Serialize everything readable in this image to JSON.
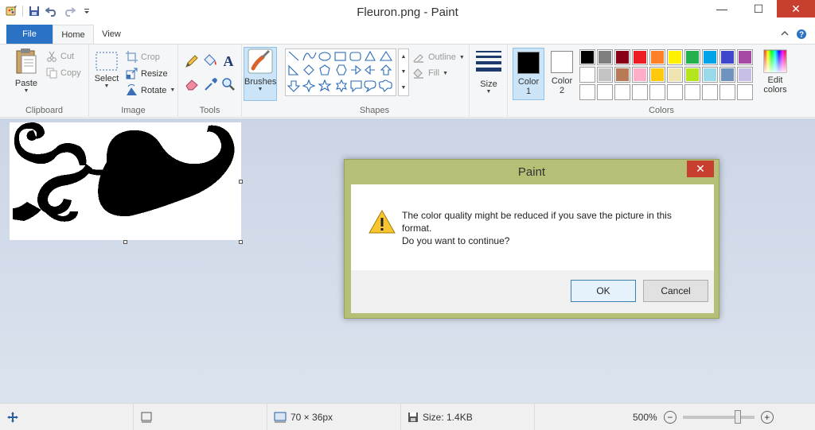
{
  "window": {
    "title": "Fleuron.png - Paint",
    "minimize_glyph": "—",
    "maximize_glyph": "☐",
    "close_glyph": "✕"
  },
  "tabs": [
    {
      "label": "File",
      "active": false
    },
    {
      "label": "Home",
      "active": true
    },
    {
      "label": "View",
      "active": false
    }
  ],
  "ribbon": {
    "clipboard": {
      "label": "Clipboard",
      "paste": "Paste",
      "cut": "Cut",
      "copy": "Copy"
    },
    "image": {
      "label": "Image",
      "select": "Select",
      "crop": "Crop",
      "resize": "Resize",
      "rotate": "Rotate"
    },
    "tools": {
      "label": "Tools"
    },
    "brushes": {
      "label": "Brushes"
    },
    "shapes": {
      "label": "Shapes",
      "outline": "Outline",
      "fill": "Fill"
    },
    "size": {
      "label": "Size"
    },
    "colors": {
      "label": "Colors",
      "color1_label": "Color",
      "color1_num": "1",
      "color1_value": "#000000",
      "color2_label": "Color",
      "color2_num": "2",
      "color2_value": "#ffffff",
      "edit_line1": "Edit",
      "edit_line2": "colors",
      "palette": [
        "#000000",
        "#7f7f7f",
        "#880015",
        "#ed1c24",
        "#ff7f27",
        "#fff200",
        "#22b14c",
        "#00a2e8",
        "#3f48cc",
        "#a349a4",
        "#ffffff",
        "#c3c3c3",
        "#b97a57",
        "#ffaec9",
        "#ffc90e",
        "#efe4b0",
        "#b5e61d",
        "#99d9ea",
        "#7092be",
        "#c8bfe7",
        "",
        "",
        "",
        "",
        "",
        "",
        "",
        "",
        "",
        ""
      ]
    }
  },
  "dialog": {
    "title": "Paint",
    "message_line1": "The color quality might be reduced if you save the picture in this",
    "message_line2": "format.",
    "message_line3": "Do you want to continue?",
    "ok": "OK",
    "cancel": "Cancel",
    "close_glyph": "✕"
  },
  "status": {
    "image_size": "70 × 36px",
    "file_size": "Size: 1.4KB",
    "zoom": "500%",
    "zoom_slider_fraction": 0.8
  }
}
